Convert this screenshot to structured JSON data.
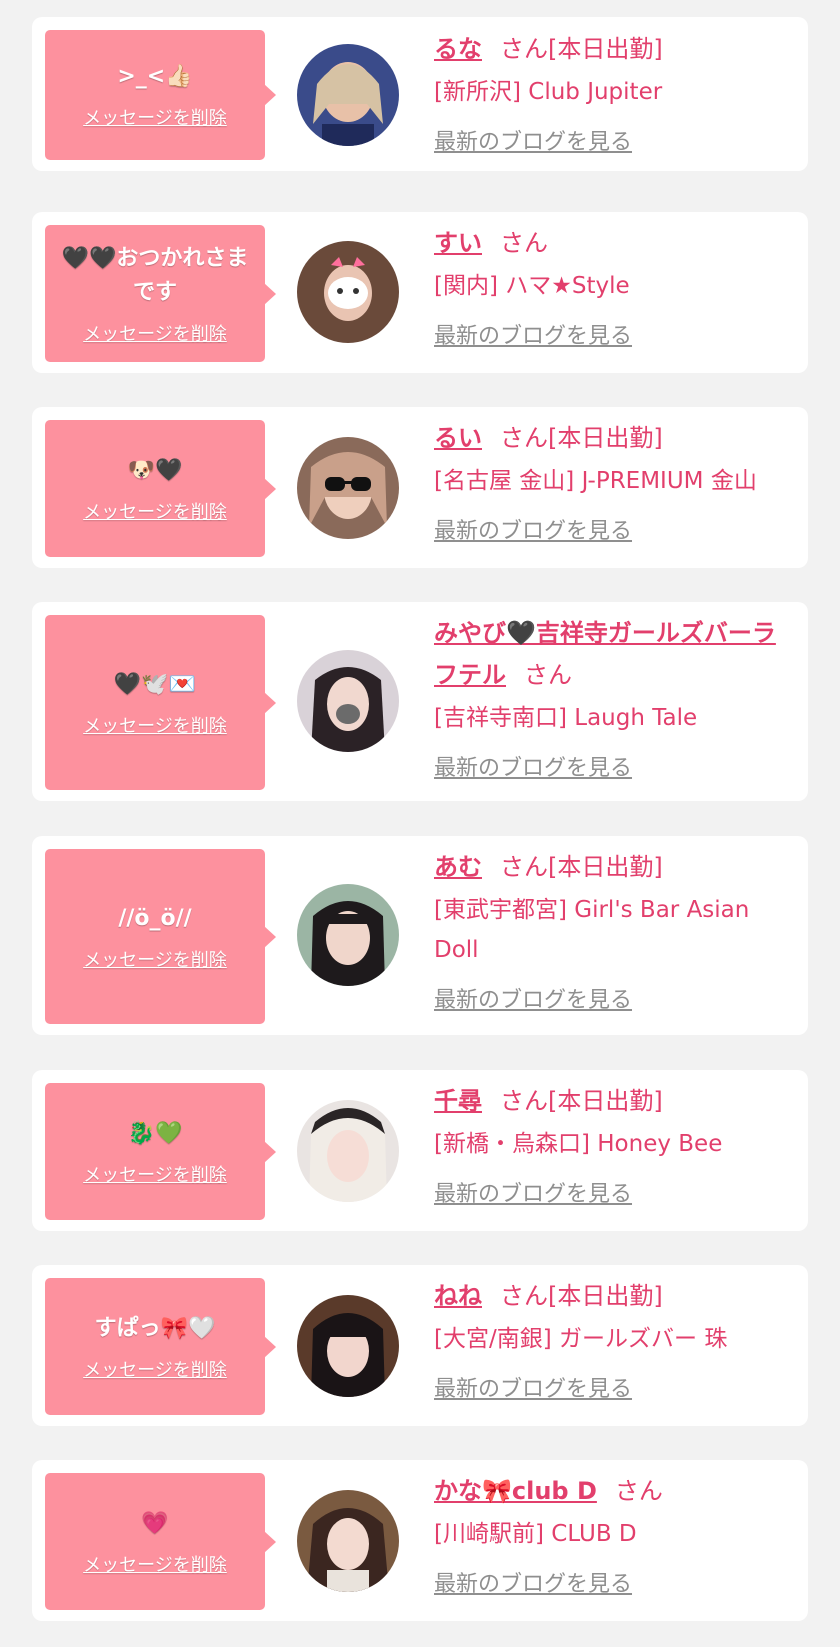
{
  "delete_label": "メッセージを削除",
  "blog_label": "最新のブログを見る",
  "san_label": "さん",
  "colors": {
    "background": "#f2f2f2",
    "bubble": "#fd919e",
    "accent": "#e23f6c",
    "muted": "#8f8f8f"
  },
  "cards": [
    {
      "message": ">_<👍🏻",
      "name": "るな",
      "status": "[本日出勤]",
      "shop": "[新所沢] Club Jupiter"
    },
    {
      "message": "🖤🖤おつかれさまです",
      "name": "すい",
      "status": "",
      "shop": "[関内] ハマ★Style"
    },
    {
      "message": "🐶🖤",
      "name": "るい",
      "status": "[本日出勤]",
      "shop": "[名古屋 金山] J-PREMIUM 金山"
    },
    {
      "message": "🖤🕊️💌",
      "name": "みやび🖤吉祥寺ガールズバーラフテル",
      "status": "",
      "shop": "[吉祥寺南口] Laugh Tale"
    },
    {
      "message": "//ö_ö//",
      "name": "あむ",
      "status": "[本日出勤]",
      "shop": "[東武宇都宮] Girl's Bar Asian Doll"
    },
    {
      "message": "🐉💚",
      "name": "千尋",
      "status": "[本日出勤]",
      "shop": "[新橋・烏森口] Honey Bee"
    },
    {
      "message": "すぱっ🎀🤍",
      "name": "ねね",
      "status": "[本日出勤]",
      "shop": "[大宮/南銀] ガールズバー 珠"
    },
    {
      "message": "💗",
      "name": "かな🎀club D",
      "status": "",
      "shop": "[川崎駅前] CLUB D"
    }
  ]
}
